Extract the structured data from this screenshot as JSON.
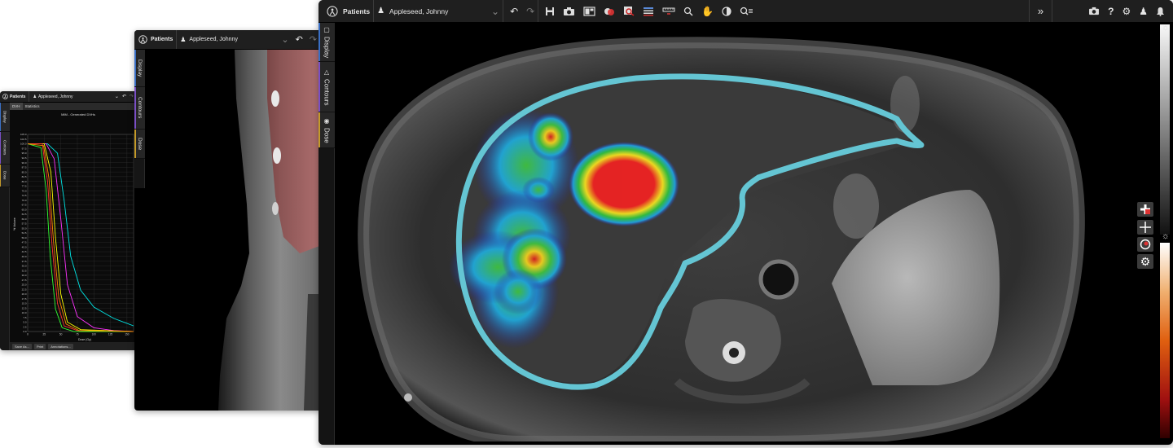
{
  "small_window": {
    "patients_label": "Patients",
    "patient_name": "Appleseed, Johnny",
    "tabs": [
      "DVH",
      "Statistics"
    ],
    "side_tabs": [
      "Display",
      "Contours",
      "Dose"
    ],
    "chart_title": "MIM - Generated DVHs",
    "footer_buttons": [
      "Save As...",
      "Print",
      "Annotations..."
    ]
  },
  "medium_window": {
    "patients_label": "Patients",
    "patient_name": "Appleseed, Johnny",
    "side_tabs": [
      "Display",
      "Contours",
      "Dose"
    ]
  },
  "main_window": {
    "patients_label": "Patients",
    "patient_name": "Appleseed, Johnny",
    "side_tabs": [
      "Display",
      "Contours",
      "Dose"
    ],
    "toolbar_icons": [
      "undo-icon",
      "redo-icon",
      "save-icon",
      "camera-icon",
      "layout-icon",
      "fusion-icon",
      "zoom-region-icon",
      "table-icon",
      "ruler-icon",
      "magnifier-icon",
      "pan-hand-icon",
      "contrast-icon",
      "query-icon"
    ],
    "right_icons": [
      "snapshot-icon",
      "help-icon",
      "settings-icon",
      "user-icon",
      "notifications-icon"
    ],
    "expand_label": "»",
    "help_label": "?",
    "side_tools": [
      "add-contour-tool",
      "crosshair-tool",
      "dose-tool",
      "view-settings-tool"
    ]
  },
  "colors": {
    "contour": "#64c5d3",
    "toolbar": "#1f1f1f",
    "display_tab": "#3a6fc4",
    "contours_tab": "#7a4fc4",
    "dose_tab": "#c49a2a"
  },
  "chart_data": {
    "type": "line",
    "title": "MIM - Generated DVHs",
    "xlabel": "Dose (Gy)",
    "ylabel": "% Volume",
    "x_ticks": [
      0,
      25,
      50,
      75,
      100,
      125,
      150
    ],
    "y_ticks": [
      0.0,
      2.5,
      5.0,
      7.5,
      10.0,
      12.5,
      15.0,
      17.5,
      20.0,
      22.5,
      25.0,
      27.5,
      30.0,
      32.5,
      35.0,
      37.5,
      40.0,
      42.5,
      45.0,
      47.5,
      50.0,
      52.5,
      55.0,
      57.5,
      60.0,
      62.5,
      65.0,
      67.5,
      70.0,
      72.5,
      75.0,
      77.5,
      80.0,
      82.5,
      85.0,
      87.5,
      90.0,
      92.5,
      95.0,
      97.5,
      100.0,
      102.5,
      105.0
    ],
    "xlim": [
      0,
      160
    ],
    "ylim": [
      0,
      105
    ],
    "grid": true,
    "series": [
      {
        "color": "#00e5e5",
        "points": [
          [
            0,
            100
          ],
          [
            30,
            100
          ],
          [
            45,
            95
          ],
          [
            55,
            70
          ],
          [
            65,
            40
          ],
          [
            80,
            22
          ],
          [
            100,
            13
          ],
          [
            130,
            7
          ],
          [
            160,
            3
          ]
        ]
      },
      {
        "color": "#ff33ff",
        "points": [
          [
            0,
            100
          ],
          [
            28,
            100
          ],
          [
            40,
            92
          ],
          [
            50,
            60
          ],
          [
            60,
            25
          ],
          [
            75,
            8
          ],
          [
            100,
            2
          ],
          [
            130,
            0.5
          ],
          [
            160,
            0
          ]
        ]
      },
      {
        "color": "#ffff00",
        "points": [
          [
            0,
            100
          ],
          [
            25,
            100
          ],
          [
            35,
            85
          ],
          [
            42,
            50
          ],
          [
            50,
            20
          ],
          [
            60,
            5
          ],
          [
            80,
            1
          ],
          [
            160,
            0
          ]
        ]
      },
      {
        "color": "#ff3333",
        "points": [
          [
            0,
            100
          ],
          [
            22,
            100
          ],
          [
            30,
            80
          ],
          [
            37,
            45
          ],
          [
            45,
            15
          ],
          [
            55,
            3
          ],
          [
            75,
            0.5
          ],
          [
            160,
            0
          ]
        ]
      },
      {
        "color": "#33ff33",
        "points": [
          [
            0,
            100
          ],
          [
            20,
            98
          ],
          [
            28,
            75
          ],
          [
            34,
            40
          ],
          [
            42,
            12
          ],
          [
            52,
            2
          ],
          [
            70,
            0
          ],
          [
            160,
            0
          ]
        ]
      },
      {
        "color": "#ff8800",
        "points": [
          [
            0,
            100
          ],
          [
            24,
            99
          ],
          [
            32,
            82
          ],
          [
            39,
            48
          ],
          [
            47,
            18
          ],
          [
            58,
            4
          ],
          [
            78,
            0.5
          ],
          [
            160,
            0
          ]
        ]
      }
    ]
  }
}
